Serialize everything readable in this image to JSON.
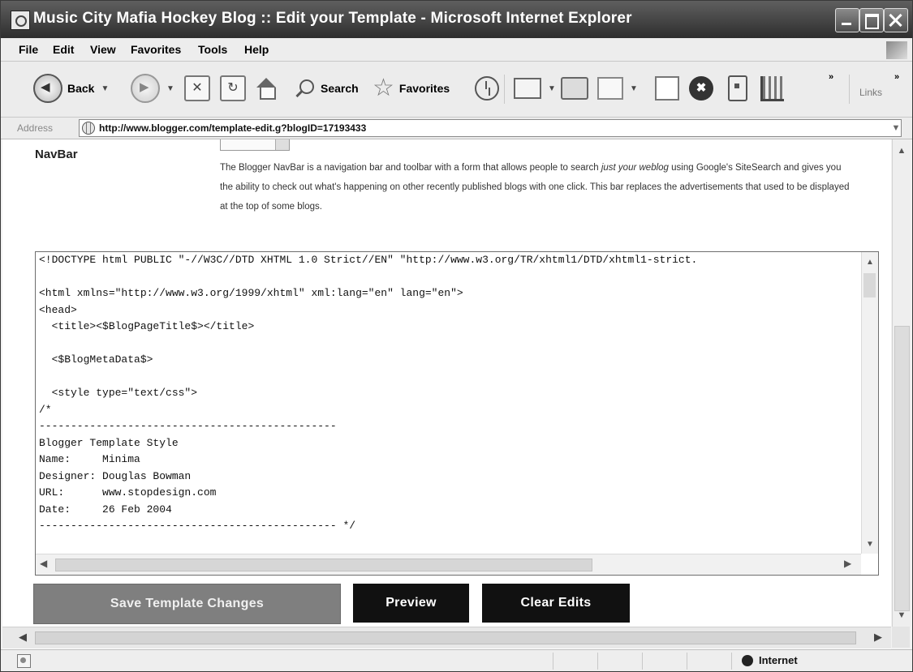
{
  "window": {
    "title": "Music City Mafia Hockey Blog :: Edit your Template - Microsoft Internet Explorer"
  },
  "menu": [
    "File",
    "Edit",
    "View",
    "Favorites",
    "Tools",
    "Help"
  ],
  "toolbar": {
    "back": "Back",
    "search": "Search",
    "favorites": "Favorites",
    "links": "Links"
  },
  "address": {
    "label": "Address",
    "url": "http://www.blogger.com/template-edit.g?blogID=17193433"
  },
  "page": {
    "navbar": {
      "heading": "NavBar",
      "description_before": "The Blogger NavBar is a navigation bar and toolbar with a form that allows people to search ",
      "description_emphasis": "just your weblog",
      "description_after": " using Google's SiteSearch and gives you the ability to check out what's happening on other recently published blogs with one click. This bar replaces the advertisements that used to be displayed at the top of some blogs."
    },
    "template_code": "<!DOCTYPE html PUBLIC \"-//W3C//DTD XHTML 1.0 Strict//EN\" \"http://www.w3.org/TR/xhtml1/DTD/xhtml1-strict.\n\n<html xmlns=\"http://www.w3.org/1999/xhtml\" xml:lang=\"en\" lang=\"en\">\n<head>\n  <title><$BlogPageTitle$></title>\n\n  <$BlogMetaData$>\n\n  <style type=\"text/css\">\n/*\n-----------------------------------------------\nBlogger Template Style\nName:     Minima\nDesigner: Douglas Bowman\nURL:      www.stopdesign.com\nDate:     26 Feb 2004\n----------------------------------------------- */",
    "buttons": {
      "save": "Save Template Changes",
      "preview": "Preview",
      "clear": "Clear Edits"
    }
  },
  "status": {
    "zone": "Internet"
  }
}
